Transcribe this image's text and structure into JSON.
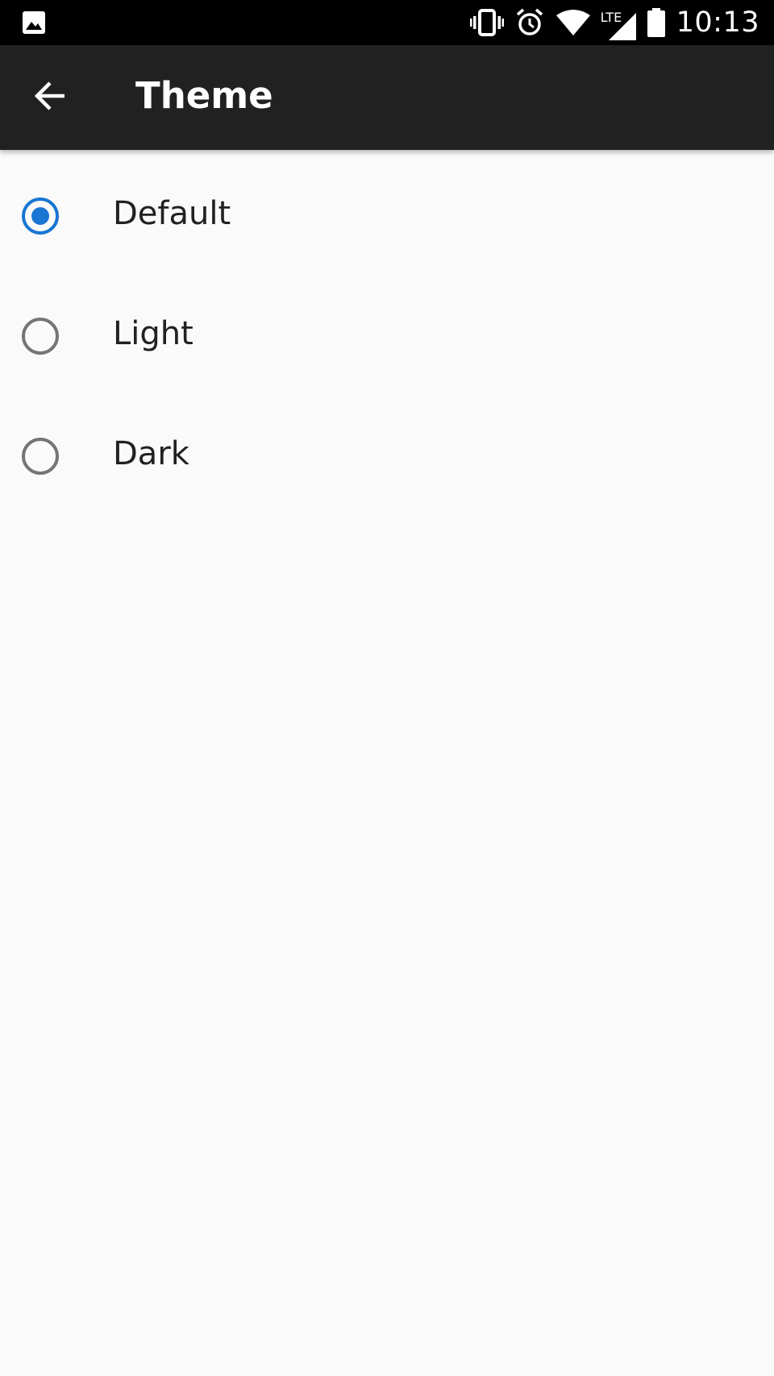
{
  "status_bar": {
    "time": "10:13",
    "network_label": "LTE",
    "icons": [
      "image-notification-icon",
      "vibrate-icon",
      "alarm-icon",
      "wifi-icon",
      "cellular-signal-icon",
      "battery-icon"
    ]
  },
  "app_bar": {
    "title": "Theme",
    "back_icon": "arrow-back-icon"
  },
  "theme_options": [
    {
      "label": "Default",
      "selected": true
    },
    {
      "label": "Light",
      "selected": false
    },
    {
      "label": "Dark",
      "selected": false
    }
  ],
  "colors": {
    "accent": "#1976d2",
    "app_bar": "#212121",
    "status_bar": "#000000",
    "background": "#fafafa",
    "radio_unchecked": "#757575"
  }
}
